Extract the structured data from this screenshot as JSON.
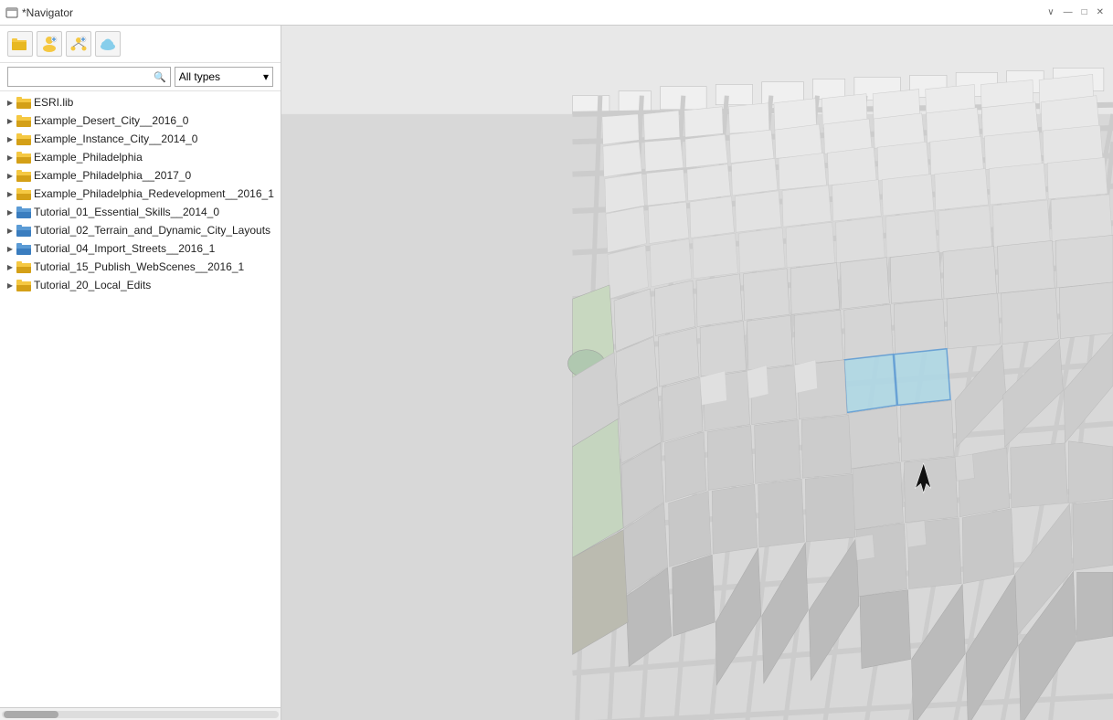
{
  "titleBar": {
    "icon": "📁",
    "title": "*Navigator",
    "closeBtn": "✕",
    "minimizeBtn": "∨",
    "collapseBtn": "—",
    "restoreBtn": "□"
  },
  "toolbar": {
    "openFolderLabel": "Open folder",
    "addUserLabel": "Add user",
    "networkLabel": "Network",
    "cloudLabel": "Cloud"
  },
  "search": {
    "placeholder": "",
    "filterLabel": "All types",
    "filterArrow": "▾"
  },
  "treeItems": [
    {
      "id": "esrilib",
      "label": "ESRI.lib",
      "type": "folder-yellow",
      "expanded": false,
      "indent": 0
    },
    {
      "id": "desert",
      "label": "Example_Desert_City__2016_0",
      "type": "folder-yellow",
      "expanded": false,
      "indent": 0
    },
    {
      "id": "instance",
      "label": "Example_Instance_City__2014_0",
      "type": "folder-yellow",
      "expanded": false,
      "indent": 0
    },
    {
      "id": "philly",
      "label": "Example_Philadelphia",
      "type": "folder-yellow",
      "expanded": false,
      "indent": 0
    },
    {
      "id": "philly2017",
      "label": "Example_Philadelphia__2017_0",
      "type": "folder-yellow",
      "expanded": false,
      "indent": 0
    },
    {
      "id": "redevelopment",
      "label": "Example_Philadelphia_Redevelopment__2016_1",
      "type": "folder-yellow",
      "expanded": false,
      "indent": 0
    },
    {
      "id": "tutorial01",
      "label": "Tutorial_01_Essential_Skills__2014_0",
      "type": "folder-blue",
      "expanded": false,
      "indent": 0
    },
    {
      "id": "tutorial02",
      "label": "Tutorial_02_Terrain_and_Dynamic_City_Layouts",
      "type": "folder-blue",
      "expanded": false,
      "indent": 0
    },
    {
      "id": "tutorial04",
      "label": "Tutorial_04_Import_Streets__2016_1",
      "type": "folder-blue",
      "expanded": false,
      "indent": 0
    },
    {
      "id": "tutorial15",
      "label": "Tutorial_15_Publish_WebScenes__2016_1",
      "type": "folder-yellow",
      "expanded": false,
      "indent": 0
    },
    {
      "id": "tutorial20",
      "label": "Tutorial_20_Local_Edits",
      "type": "folder-yellow",
      "expanded": false,
      "indent": 0
    }
  ],
  "map": {
    "bgColor": "#e0e0e0",
    "highlightColor": "#add8e6",
    "description": "3D city map view of Philadelphia"
  }
}
